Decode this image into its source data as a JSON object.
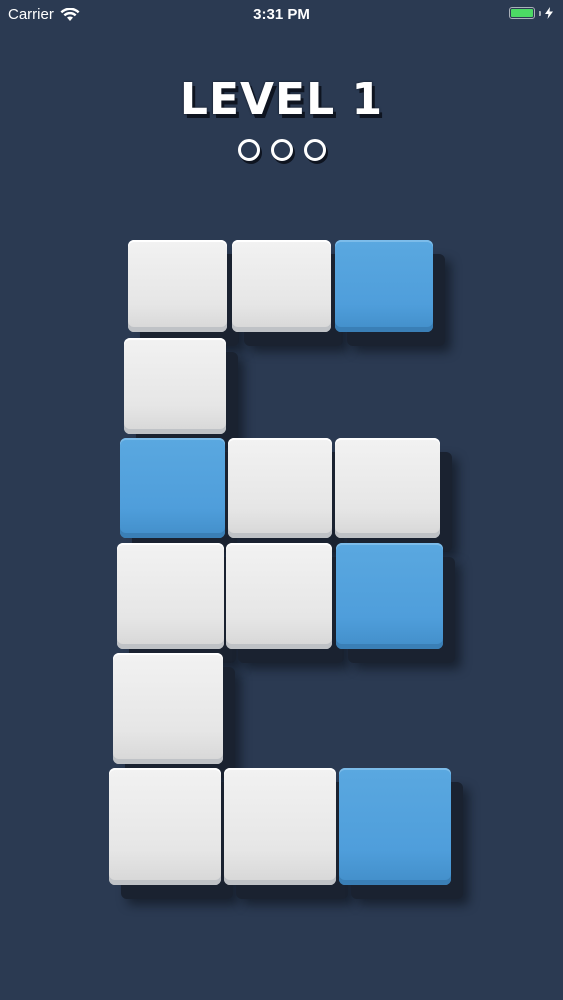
{
  "status_bar": {
    "carrier": "Carrier",
    "time": "3:31 PM",
    "battery_color": "#4cd964",
    "wifi_icon": "wifi-icon",
    "charging_icon": "bolt-icon"
  },
  "header": {
    "title": "LEVEL 1",
    "progress_dots": [
      {
        "filled": false
      },
      {
        "filled": false
      },
      {
        "filled": false
      }
    ]
  },
  "board": {
    "colors": {
      "white": "#e8e8e8",
      "blue": "#4f9edb",
      "background": "#2b3a52"
    },
    "rows": [
      [
        "white",
        "white",
        "blue"
      ],
      [
        "white",
        "empty",
        "empty"
      ],
      [
        "blue",
        "white",
        "white"
      ],
      [
        "white",
        "white",
        "blue"
      ],
      [
        "white",
        "empty",
        "empty"
      ],
      [
        "white",
        "white",
        "blue"
      ]
    ]
  }
}
